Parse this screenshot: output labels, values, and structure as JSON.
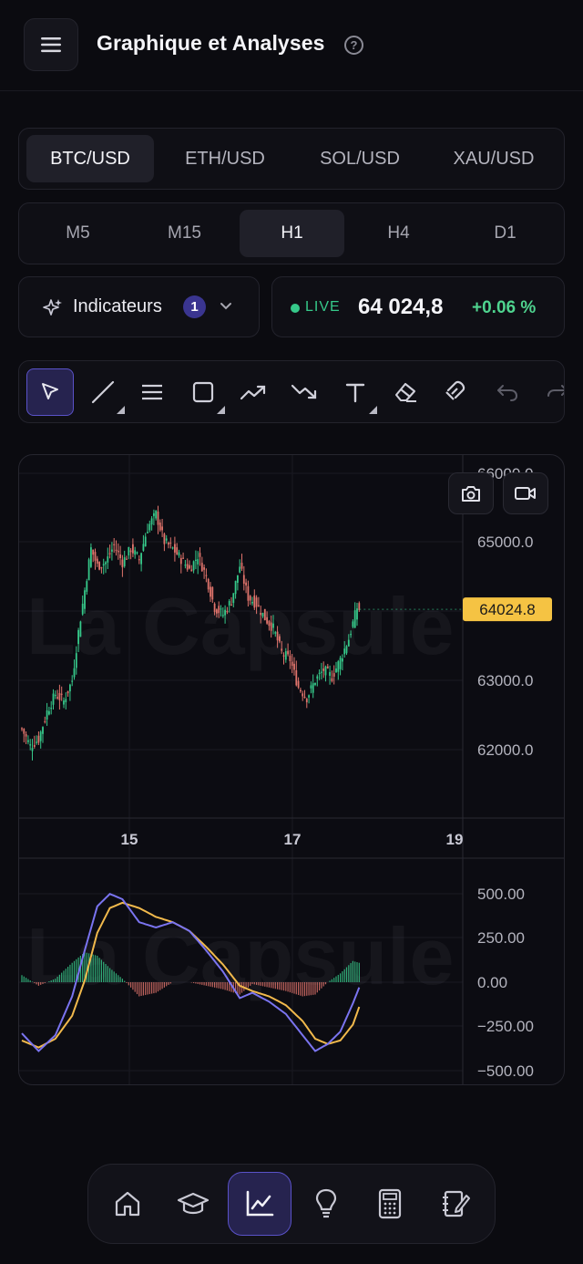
{
  "header": {
    "title": "Graphique et Analyses",
    "help_glyph": "?",
    "menu_icon": "hamburger-menu-icon"
  },
  "pairs": [
    {
      "label": "BTC/USD",
      "active": true
    },
    {
      "label": "ETH/USD",
      "active": false
    },
    {
      "label": "SOL/USD",
      "active": false
    },
    {
      "label": "XAU/USD",
      "active": false
    }
  ],
  "timeframes": [
    {
      "label": "M5",
      "active": false
    },
    {
      "label": "M15",
      "active": false
    },
    {
      "label": "H1",
      "active": true
    },
    {
      "label": "H4",
      "active": false
    },
    {
      "label": "D1",
      "active": false
    }
  ],
  "indicators": {
    "label": "Indicateurs",
    "count": "1"
  },
  "live": {
    "label": "LIVE",
    "price": "64 024,8",
    "change": "+0.06 %"
  },
  "toolbar": {
    "tools": [
      "cursor-icon",
      "trend-line-icon",
      "horizontal-lines-icon",
      "rectangle-icon",
      "arrow-up-trend-icon",
      "arrow-down-trend-icon",
      "text-icon",
      "eraser-icon",
      "magnet-icon",
      "undo-icon",
      "redo-icon"
    ]
  },
  "chart": {
    "watermark": "La Capsule",
    "price_badge": "64024.8",
    "colors": {
      "up": "#36c98a",
      "down": "#e0746c",
      "badge": "#f5c343",
      "macd": "#7a74f0",
      "signal": "#f1b94c",
      "hist_up": "#36c98a",
      "hist_down": "#e0746c"
    }
  },
  "chart_data": [
    {
      "type": "candlestick",
      "x_tick_labels": [
        "15",
        "17",
        "19"
      ],
      "y_tick_labels": [
        "66000.0",
        "65000.0",
        "63000.0",
        "62000.0"
      ],
      "ylim": [
        61000,
        66200
      ],
      "last_price": 64024.8,
      "close_path": [
        {
          "i": 0,
          "v": 62300
        },
        {
          "i": 4,
          "v": 62050
        },
        {
          "i": 8,
          "v": 62150
        },
        {
          "i": 12,
          "v": 62550
        },
        {
          "i": 16,
          "v": 62800
        },
        {
          "i": 20,
          "v": 62700
        },
        {
          "i": 24,
          "v": 63000
        },
        {
          "i": 27,
          "v": 63700
        },
        {
          "i": 30,
          "v": 64300
        },
        {
          "i": 33,
          "v": 64900
        },
        {
          "i": 36,
          "v": 64650
        },
        {
          "i": 40,
          "v": 64700
        },
        {
          "i": 44,
          "v": 64950
        },
        {
          "i": 48,
          "v": 64700
        },
        {
          "i": 52,
          "v": 64900
        },
        {
          "i": 56,
          "v": 64750
        },
        {
          "i": 60,
          "v": 65200
        },
        {
          "i": 64,
          "v": 65400
        },
        {
          "i": 68,
          "v": 65000
        },
        {
          "i": 72,
          "v": 64900
        },
        {
          "i": 76,
          "v": 64750
        },
        {
          "i": 80,
          "v": 64600
        },
        {
          "i": 84,
          "v": 64800
        },
        {
          "i": 88,
          "v": 64500
        },
        {
          "i": 92,
          "v": 64050
        },
        {
          "i": 96,
          "v": 63950
        },
        {
          "i": 100,
          "v": 64150
        },
        {
          "i": 104,
          "v": 64650
        },
        {
          "i": 108,
          "v": 64200
        },
        {
          "i": 112,
          "v": 64100
        },
        {
          "i": 116,
          "v": 63900
        },
        {
          "i": 120,
          "v": 63750
        },
        {
          "i": 124,
          "v": 63400
        },
        {
          "i": 128,
          "v": 63300
        },
        {
          "i": 132,
          "v": 62900
        },
        {
          "i": 136,
          "v": 62750
        },
        {
          "i": 140,
          "v": 63000
        },
        {
          "i": 144,
          "v": 63150
        },
        {
          "i": 148,
          "v": 63050
        },
        {
          "i": 152,
          "v": 63300
        },
        {
          "i": 156,
          "v": 63600
        },
        {
          "i": 160,
          "v": 64050
        },
        {
          "i": 161,
          "v": 64024.8
        }
      ]
    },
    {
      "type": "macd",
      "y_tick_labels": [
        "500.00",
        "250.00",
        "0.00",
        "−250.00",
        "−500.00"
      ],
      "ylim": [
        -500,
        500
      ],
      "macd_path": [
        {
          "i": 0,
          "v": -290
        },
        {
          "i": 8,
          "v": -390
        },
        {
          "i": 16,
          "v": -300
        },
        {
          "i": 24,
          "v": -80
        },
        {
          "i": 30,
          "v": 180
        },
        {
          "i": 36,
          "v": 430
        },
        {
          "i": 42,
          "v": 500
        },
        {
          "i": 48,
          "v": 470
        },
        {
          "i": 56,
          "v": 340
        },
        {
          "i": 64,
          "v": 310
        },
        {
          "i": 72,
          "v": 340
        },
        {
          "i": 80,
          "v": 290
        },
        {
          "i": 88,
          "v": 180
        },
        {
          "i": 96,
          "v": 60
        },
        {
          "i": 104,
          "v": -90
        },
        {
          "i": 110,
          "v": -60
        },
        {
          "i": 118,
          "v": -110
        },
        {
          "i": 126,
          "v": -180
        },
        {
          "i": 134,
          "v": -300
        },
        {
          "i": 140,
          "v": -390
        },
        {
          "i": 146,
          "v": -350
        },
        {
          "i": 152,
          "v": -280
        },
        {
          "i": 158,
          "v": -120
        },
        {
          "i": 161,
          "v": -30
        }
      ],
      "signal_path": [
        {
          "i": 0,
          "v": -330
        },
        {
          "i": 8,
          "v": -370
        },
        {
          "i": 16,
          "v": -320
        },
        {
          "i": 24,
          "v": -190
        },
        {
          "i": 30,
          "v": 10
        },
        {
          "i": 36,
          "v": 280
        },
        {
          "i": 42,
          "v": 420
        },
        {
          "i": 48,
          "v": 450
        },
        {
          "i": 56,
          "v": 420
        },
        {
          "i": 64,
          "v": 370
        },
        {
          "i": 72,
          "v": 340
        },
        {
          "i": 80,
          "v": 290
        },
        {
          "i": 88,
          "v": 200
        },
        {
          "i": 96,
          "v": 100
        },
        {
          "i": 104,
          "v": -20
        },
        {
          "i": 110,
          "v": -50
        },
        {
          "i": 118,
          "v": -80
        },
        {
          "i": 126,
          "v": -130
        },
        {
          "i": 134,
          "v": -220
        },
        {
          "i": 140,
          "v": -320
        },
        {
          "i": 146,
          "v": -350
        },
        {
          "i": 152,
          "v": -330
        },
        {
          "i": 158,
          "v": -240
        },
        {
          "i": 161,
          "v": -140
        }
      ]
    }
  ],
  "bottom_nav": [
    {
      "icon": "home-icon",
      "active": false
    },
    {
      "icon": "graduation-cap-icon",
      "active": false
    },
    {
      "icon": "chart-line-icon",
      "active": true
    },
    {
      "icon": "lightbulb-icon",
      "active": false
    },
    {
      "icon": "calculator-icon",
      "active": false
    },
    {
      "icon": "notebook-edit-icon",
      "active": false
    }
  ]
}
